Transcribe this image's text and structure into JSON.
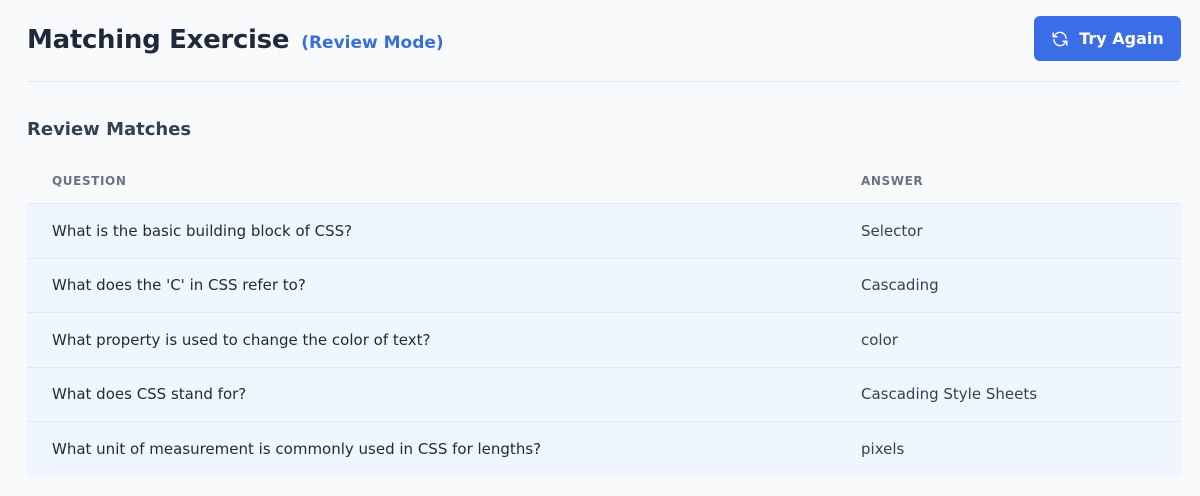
{
  "header": {
    "title": "Matching Exercise",
    "mode": "(Review Mode)",
    "try_again_label": "Try Again"
  },
  "section": {
    "title": "Review Matches"
  },
  "table": {
    "columns": [
      "QUESTION",
      "ANSWER"
    ],
    "rows": [
      {
        "question": "What is the basic building block of CSS?",
        "answer": "Selector"
      },
      {
        "question": "What does the 'C' in CSS refer to?",
        "answer": "Cascading"
      },
      {
        "question": "What property is used to change the color of text?",
        "answer": "color"
      },
      {
        "question": "What does CSS stand for?",
        "answer": "Cascading Style Sheets"
      },
      {
        "question": "What unit of measurement is commonly used in CSS for lengths?",
        "answer": "pixels"
      }
    ]
  },
  "icons": {
    "try_again": "refresh-icon"
  },
  "colors": {
    "accent": "#3b6ee6",
    "mode_text": "#3b6fd8",
    "row_background": "#eff6ff",
    "page_background": "#f8fafc"
  }
}
